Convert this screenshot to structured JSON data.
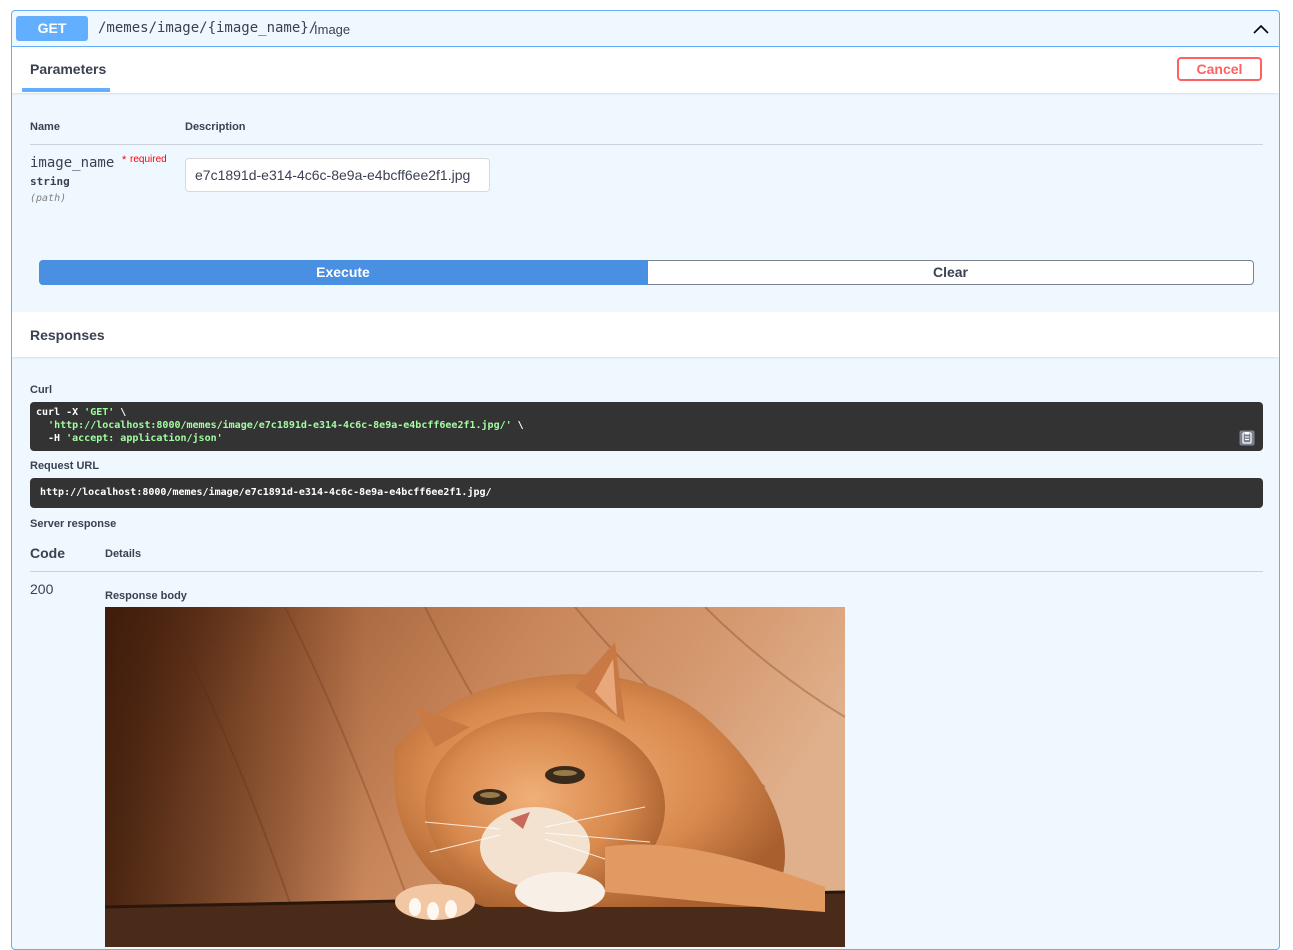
{
  "operation": {
    "method": "GET",
    "path": "/memes/image/{image_name}/",
    "summary": "Image"
  },
  "parameters": {
    "tab_label": "Parameters",
    "cancel_label": "Cancel",
    "col_name": "Name",
    "col_description": "Description",
    "items": [
      {
        "name": "image_name",
        "required_star": "*",
        "required_text": "required",
        "type": "string",
        "in": "(path)",
        "value": "e7c1891d-e314-4c6c-8e9a-e4bcff6ee2f1.jpg"
      }
    ]
  },
  "actions": {
    "execute_label": "Execute",
    "clear_label": "Clear"
  },
  "responses": {
    "title": "Responses",
    "curl_label": "Curl",
    "curl": {
      "line1_cmd": "curl -X ",
      "line1_method": "'GET'",
      "line1_tail": " \\",
      "line2_indent": "  ",
      "line2_url": "'http://localhost:8000/memes/image/e7c1891d-e314-4c6c-8e9a-e4bcff6ee2f1.jpg/'",
      "line2_tail": " \\",
      "line3_flag": "  -H ",
      "line3_header": "'accept: application/json'"
    },
    "request_url_label": "Request URL",
    "request_url": "http://localhost:8000/memes/image/e7c1891d-e314-4c6c-8e9a-e4bcff6ee2f1.jpg/",
    "server_response_label": "Server response",
    "code_label": "Code",
    "details_label": "Details",
    "status_code": "200",
    "response_body_label": "Response body"
  },
  "icons": {
    "collapse": "chevron-up-icon",
    "copy": "clipboard-copy-icon"
  },
  "colors": {
    "get_accent": "#61affe",
    "execute": "#4990e2",
    "cancel": "#ff6060",
    "code_bg": "#333333",
    "code_string": "#a2fca2"
  }
}
